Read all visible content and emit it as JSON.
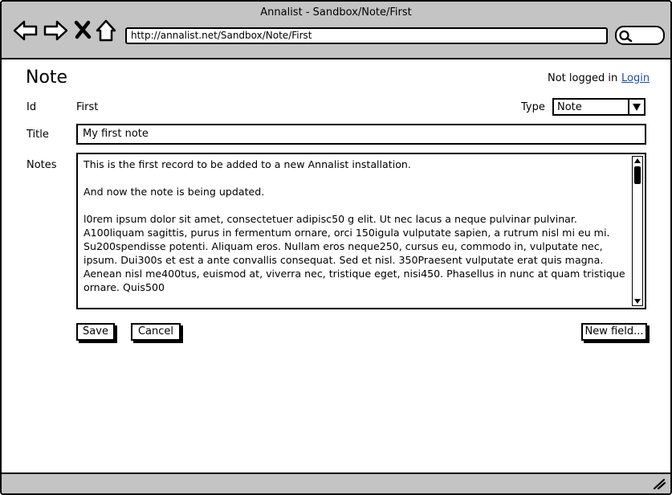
{
  "window": {
    "title": "Annalist - Sandbox/Note/First"
  },
  "browser": {
    "url": "http://annalist.net/Sandbox/Note/First",
    "icons": [
      "back-arrow-icon",
      "forward-arrow-icon",
      "stop-icon",
      "home-icon",
      "search-icon"
    ]
  },
  "page": {
    "title": "Note",
    "login_status": "Not logged in",
    "login_link": "Login"
  },
  "form": {
    "id_label": "Id",
    "id_value": "First",
    "type_label": "Type",
    "type_value": "Note",
    "title_label": "Title",
    "title_value": "My first note",
    "notes_label": "Notes",
    "notes_paragraphs": [
      "This is the first record to be added to a new Annalist installation.",
      "And now the note is being updated.",
      "l0rem ipsum dolor sit amet, consectetuer adipisc50 g elit. Ut nec lacus a neque pulvinar pulvinar. A100liquam sagittis, purus in fermentum ornare, orci 150igula vulputate sapien, a rutrum nisl mi eu mi. Su200spendisse potenti. Aliquam eros. Nullam eros neque250, cursus eu, commodo in, vulputate nec, ipsum. Dui300s et est a ante convallis consequat. Sed et nisl. 350Praesent vulputate erat quis magna. Aenean nisl me400tus, euismod at, viverra nec, tristique eget, nisi450. Phasellus in nunc at quam tristique ornare. Quis500"
    ]
  },
  "buttons": {
    "save": "Save",
    "cancel": "Cancel",
    "new_field": "New field..."
  }
}
